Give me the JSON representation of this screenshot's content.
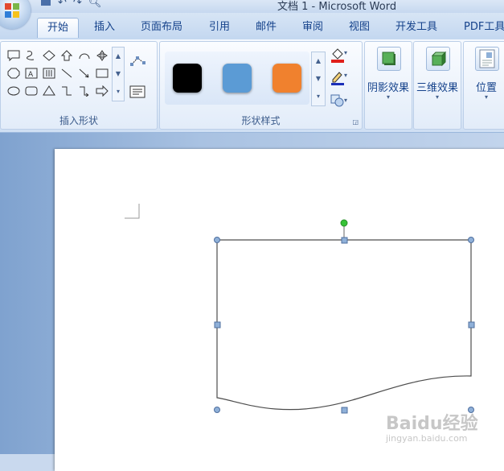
{
  "window": {
    "title": "文档 1 - Microsoft Word"
  },
  "tabs": [
    {
      "label": "开始",
      "active": true
    },
    {
      "label": "插入"
    },
    {
      "label": "页面布局"
    },
    {
      "label": "引用"
    },
    {
      "label": "邮件"
    },
    {
      "label": "审阅"
    },
    {
      "label": "视图"
    },
    {
      "label": "开发工具"
    },
    {
      "label": "PDF工具"
    }
  ],
  "ribbon": {
    "insert_shapes": {
      "label": "插入形状"
    },
    "shape_styles": {
      "label": "形状样式",
      "swatches": [
        {
          "name": "black-style",
          "color": "#000000"
        },
        {
          "name": "blue-style",
          "color": "#5b9bd5"
        },
        {
          "name": "orange-style",
          "color": "#f0812e"
        }
      ]
    },
    "shadow_effects": {
      "label": "阴影效果"
    },
    "threed_effects": {
      "label": "三维效果"
    },
    "position": {
      "label": "位置"
    }
  },
  "watermark": {
    "logo": "Baidu经验",
    "url": "jingyan.baidu.com"
  },
  "colors": {
    "accent_tab": "#15428b",
    "handle": "#6d8fbf",
    "rotate_handle": "#36c236"
  }
}
